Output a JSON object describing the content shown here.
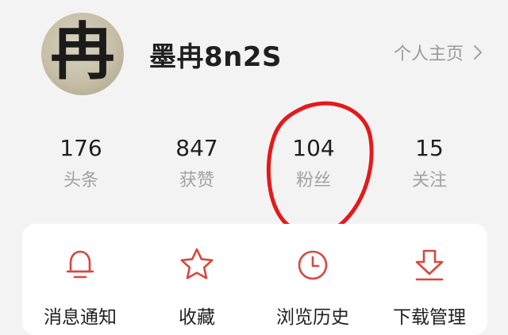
{
  "profile": {
    "avatar_glyph": "冉",
    "username": "墨冉8n2S",
    "homepage_label": "个人主页"
  },
  "stats": [
    {
      "value": "176",
      "label": "头条"
    },
    {
      "value": "847",
      "label": "获赞"
    },
    {
      "value": "104",
      "label": "粉丝"
    },
    {
      "value": "15",
      "label": "关注"
    }
  ],
  "actions": [
    {
      "label": "消息通知",
      "icon": "bell-icon"
    },
    {
      "label": "收藏",
      "icon": "star-icon"
    },
    {
      "label": "浏览历史",
      "icon": "clock-icon"
    },
    {
      "label": "下载管理",
      "icon": "download-icon"
    }
  ],
  "colors": {
    "accent": "#d9473f",
    "annotation": "#e5191b",
    "muted_text": "#a2a2a2",
    "background": "#f3f3f3"
  }
}
